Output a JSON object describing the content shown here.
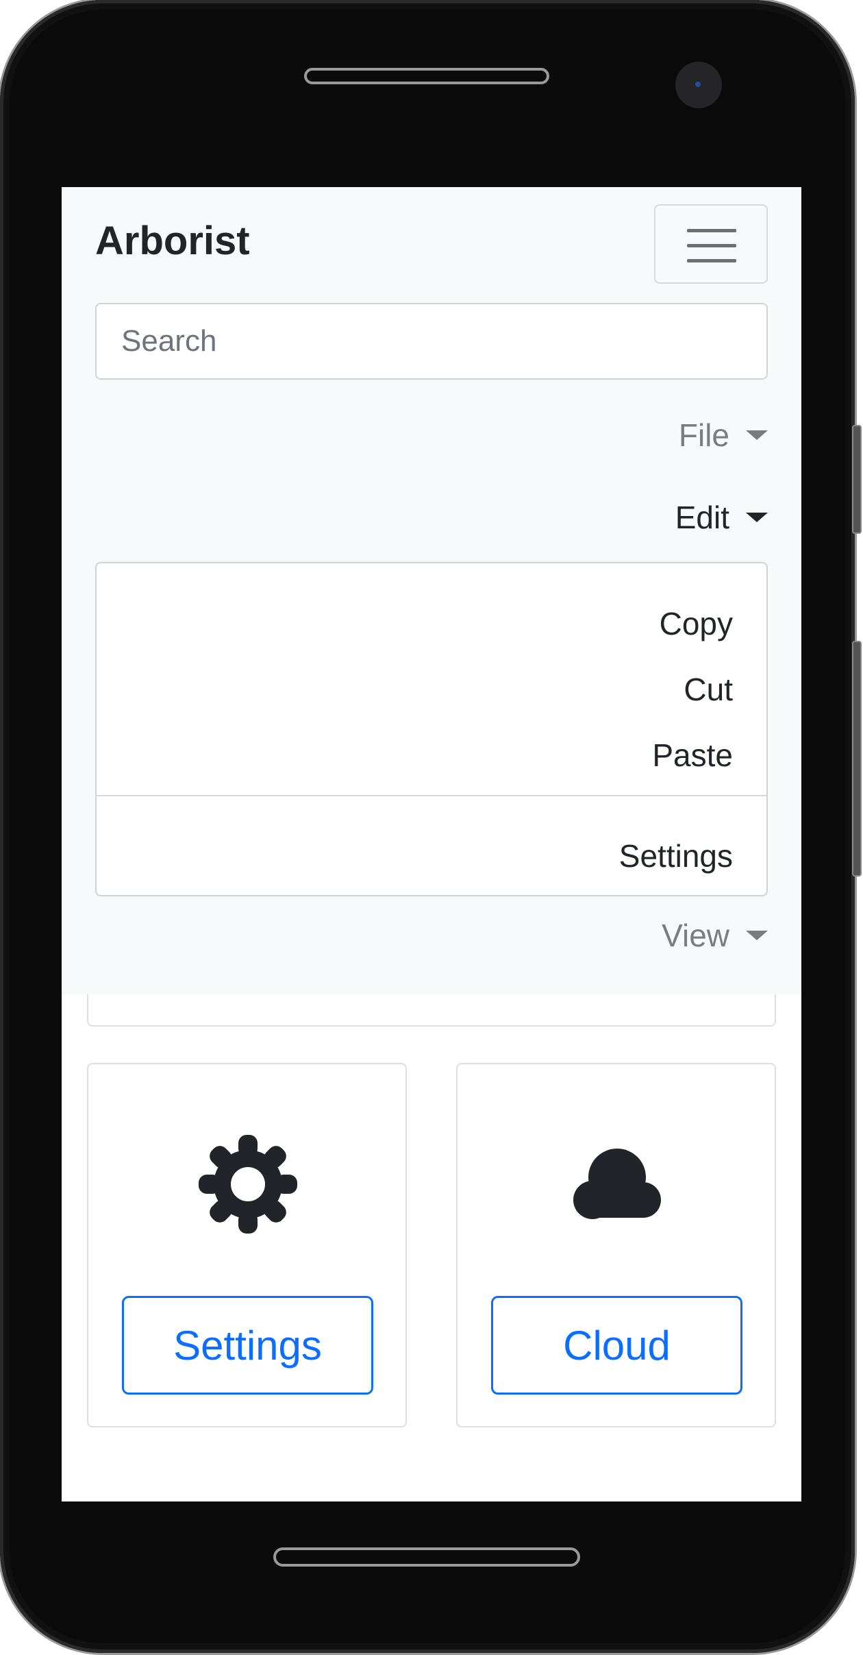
{
  "app": {
    "brand": "Arborist"
  },
  "search": {
    "placeholder": "Search"
  },
  "menu": {
    "file": "File",
    "edit": "Edit",
    "view": "View",
    "edit_dropdown": {
      "items": [
        "Copy",
        "Cut",
        "Paste"
      ],
      "footer_item": "Settings"
    }
  },
  "cards": [
    {
      "icon": "gear-icon",
      "button_label": "Settings"
    },
    {
      "icon": "cloud-icon",
      "button_label": "Cloud"
    }
  ],
  "colors": {
    "navbar_bg": "#f8f9fa",
    "primary": "#0d6efd",
    "text": "#212529",
    "muted": "#7a7d80",
    "icon": "#212529"
  }
}
